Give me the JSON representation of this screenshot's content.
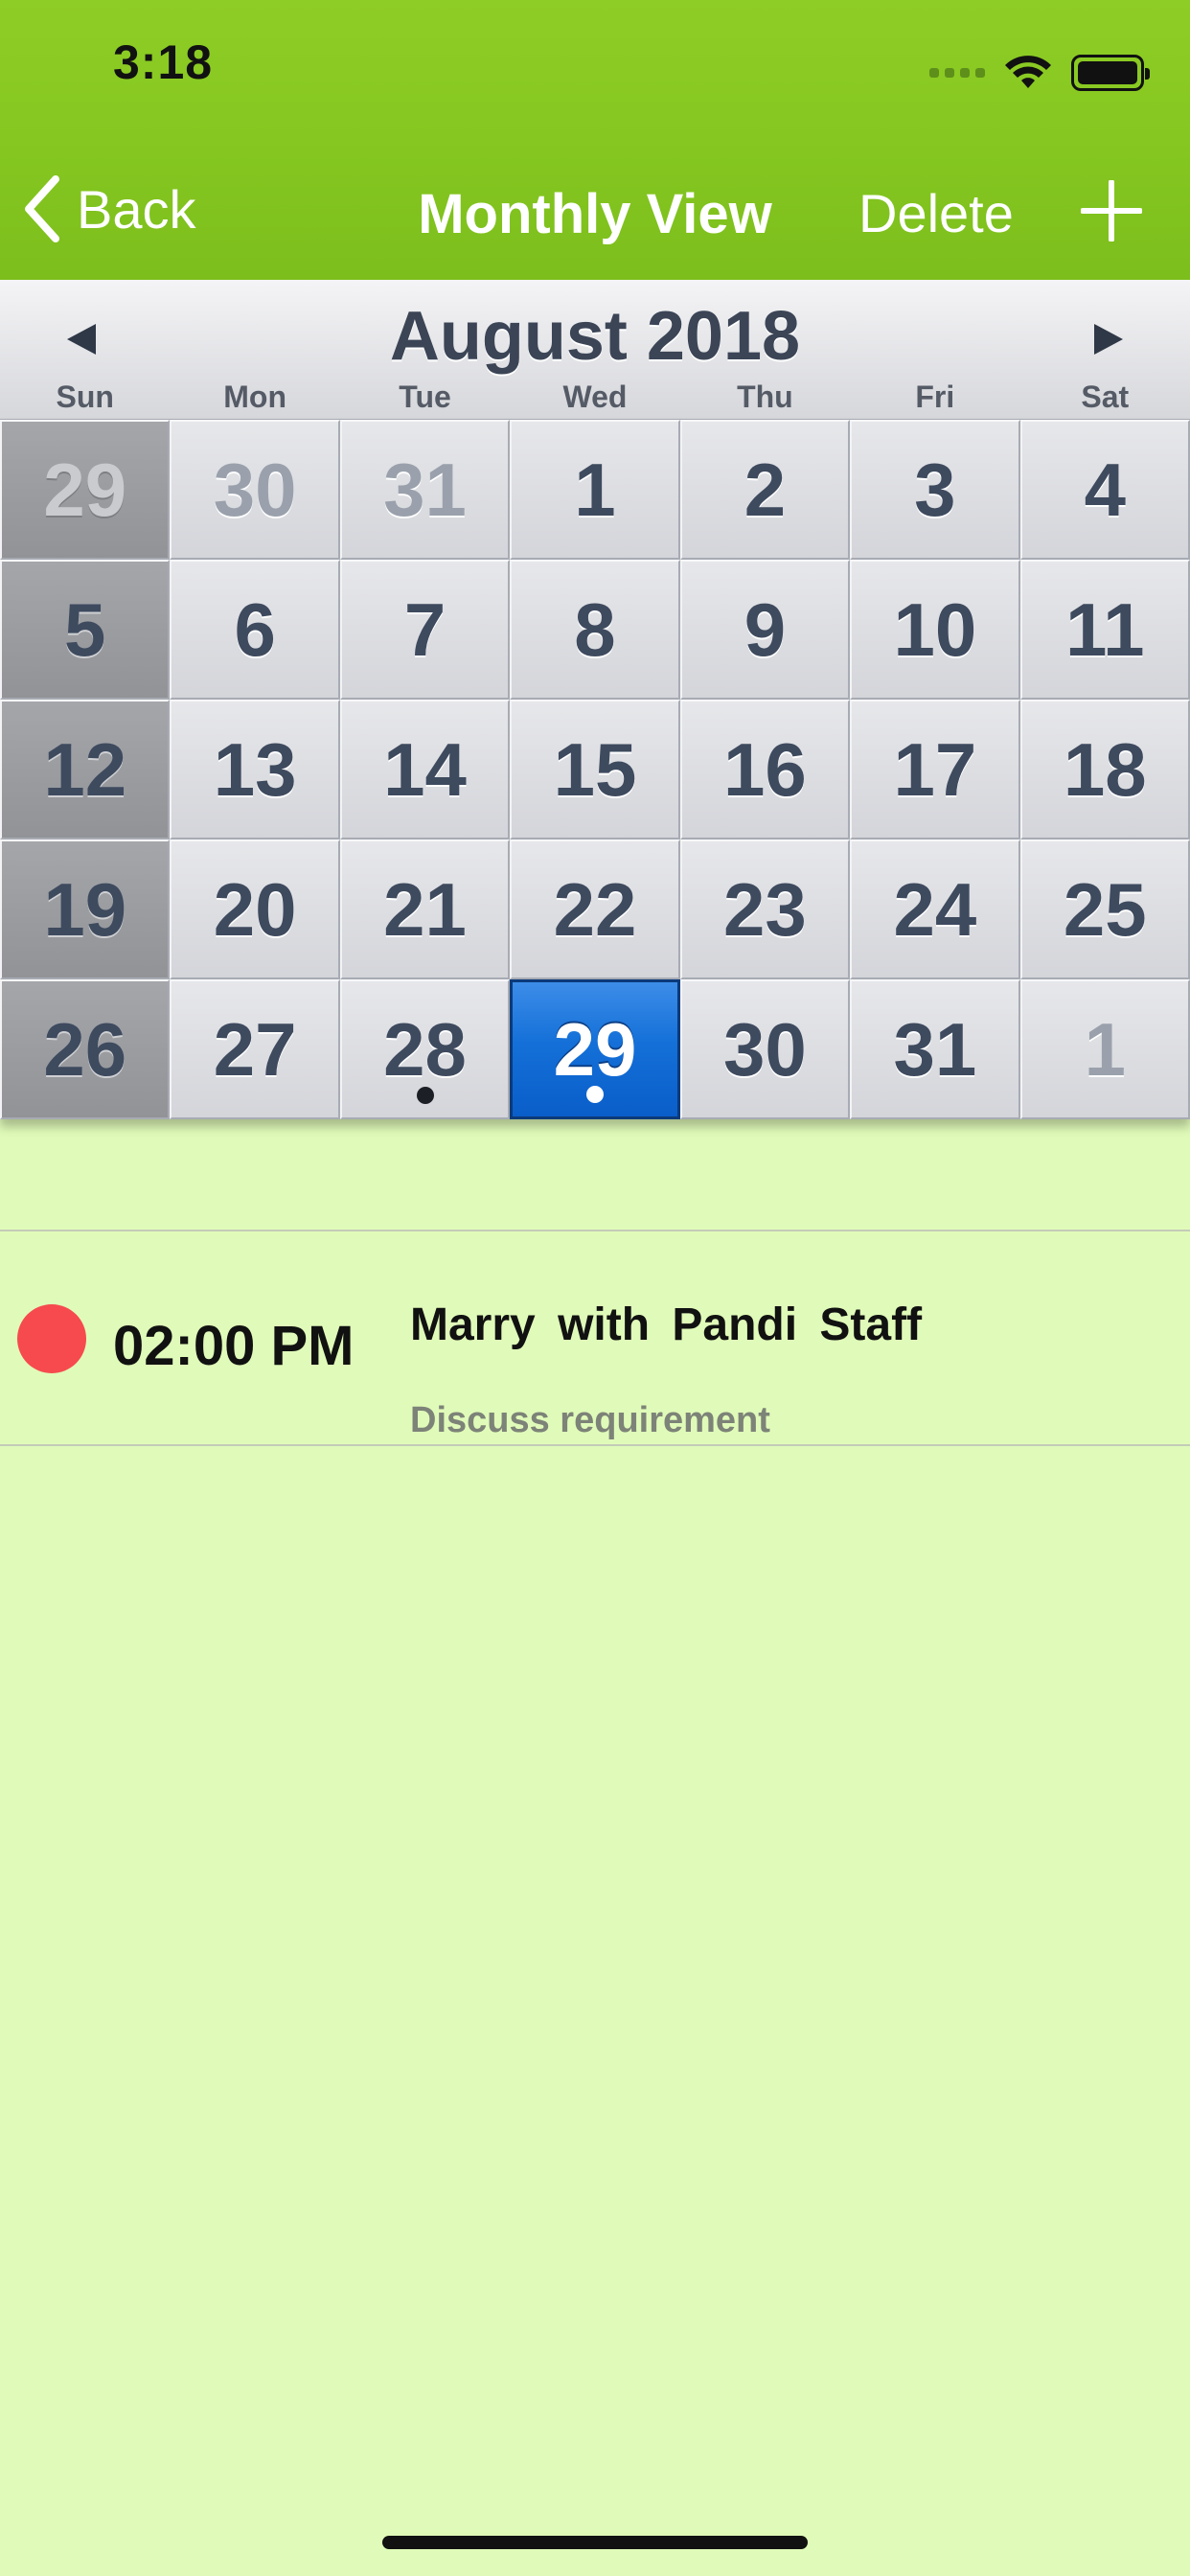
{
  "status_bar": {
    "time": "3:18"
  },
  "nav": {
    "back_label": "Back",
    "title": "Monthly View",
    "delete_label": "Delete",
    "add_icon": "plus-icon"
  },
  "calendar": {
    "month_title": "August 2018",
    "weekdays": [
      "Sun",
      "Mon",
      "Tue",
      "Wed",
      "Thu",
      "Fri",
      "Sat"
    ],
    "weeks": [
      [
        "29",
        "30",
        "31",
        "1",
        "2",
        "3",
        "4"
      ],
      [
        "5",
        "6",
        "7",
        "8",
        "9",
        "10",
        "11"
      ],
      [
        "12",
        "13",
        "14",
        "15",
        "16",
        "17",
        "18"
      ],
      [
        "19",
        "20",
        "21",
        "22",
        "23",
        "24",
        "25"
      ],
      [
        "26",
        "27",
        "28",
        "29",
        "30",
        "31",
        "1"
      ]
    ],
    "selected_day": "29",
    "days_with_events": [
      "28",
      "29"
    ],
    "selected_color": "#1470d8"
  },
  "events": [
    {
      "time": "02:00 PM",
      "title": "Marry  with  Pandi Staff",
      "description": "Discuss requirement",
      "color": "#f64a4f"
    }
  ],
  "colors": {
    "nav_green": "#86c721",
    "background": "#e0fbb9"
  }
}
